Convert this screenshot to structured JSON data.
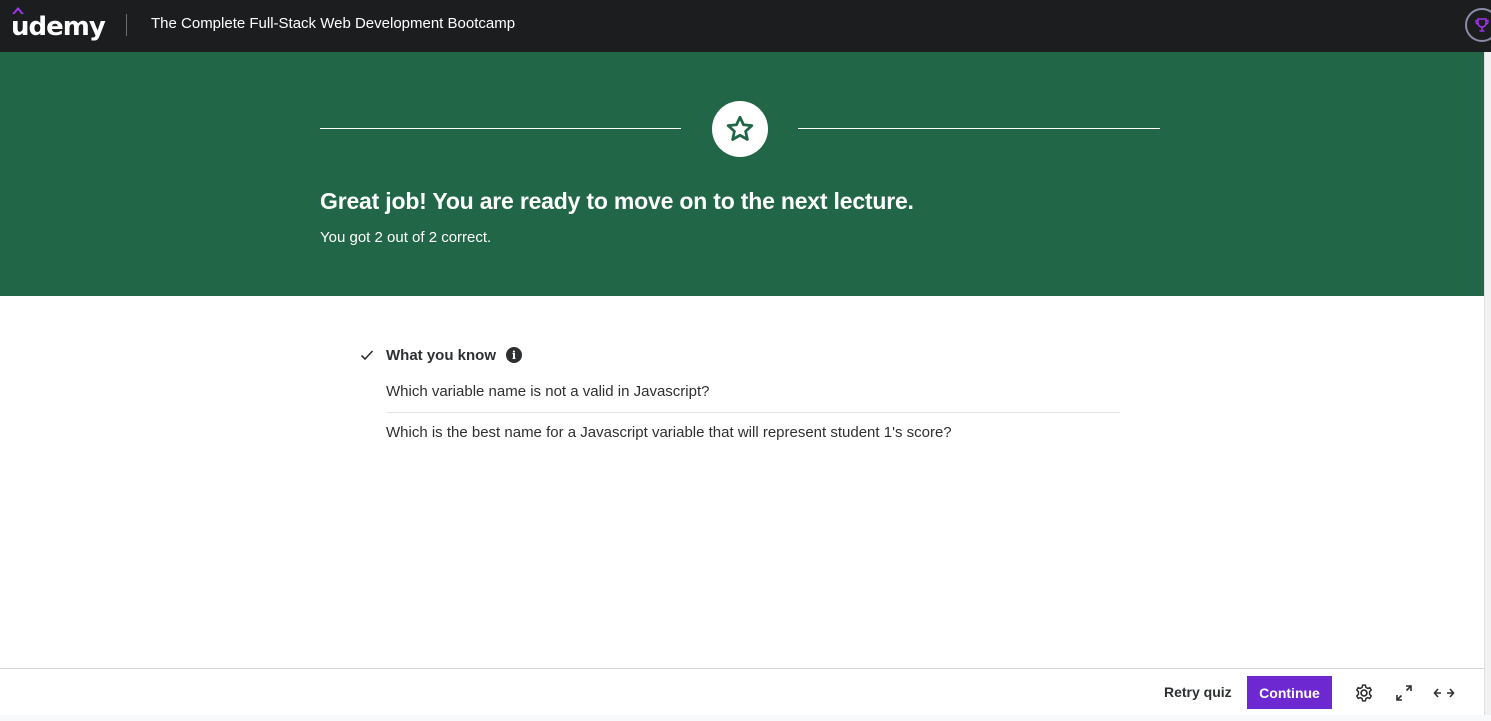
{
  "header": {
    "logo_text": "udemy",
    "course_title": "The Complete Full-Stack Web Development Bootcamp",
    "trophy_icon": "trophy-icon"
  },
  "hero": {
    "icon": "star-icon",
    "title": "Great job! You are ready to move on to the next lecture.",
    "subtitle": "You got 2 out of 2 correct.",
    "background_color": "#216647"
  },
  "results": {
    "section_label": "What you know",
    "info_icon_glyph": "i",
    "questions": [
      "Which variable name is not a valid in Javascript?",
      "Which is the best name for a Javascript variable that will represent student 1's score?"
    ]
  },
  "footer": {
    "retry_label": "Retry quiz",
    "continue_label": "Continue",
    "accent_color": "#6d28d2",
    "icons": [
      "gear-icon",
      "expand-icon",
      "horizontal-arrows-icon"
    ]
  }
}
